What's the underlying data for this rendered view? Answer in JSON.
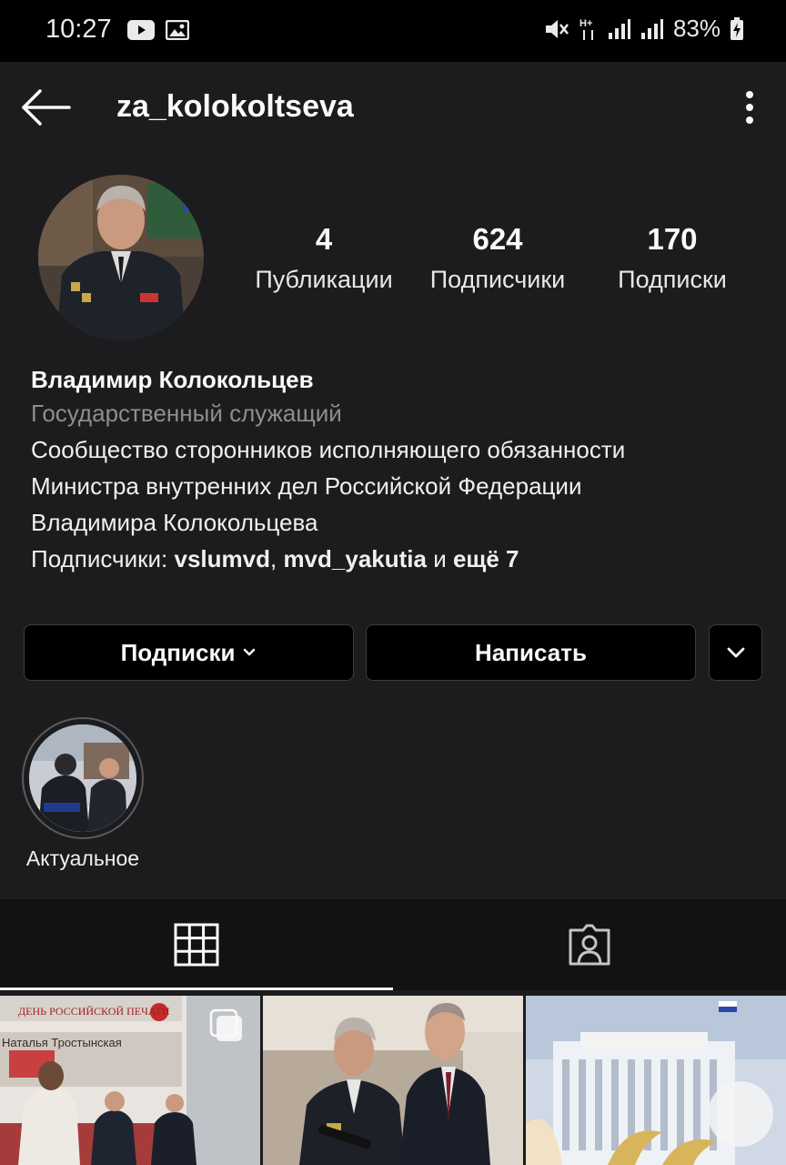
{
  "status_bar": {
    "time": "10:27",
    "battery": "83%",
    "icons": [
      "youtube-icon",
      "gallery-icon",
      "mute-icon",
      "network-h-plus-icon",
      "signal-icon",
      "signal-icon",
      "battery-charging-icon"
    ]
  },
  "header": {
    "username": "za_kolokoltseva",
    "back_icon": "arrow-left-icon",
    "more_icon": "more-vertical-icon"
  },
  "stats": [
    {
      "value": "4",
      "label": "Публикации"
    },
    {
      "value": "624",
      "label": "Подписчики"
    },
    {
      "value": "170",
      "label": "Подписки"
    }
  ],
  "bio": {
    "name": "Владимир Колокольцев",
    "category": "Государственный служащий",
    "lines": [
      "Сообщество сторонников исполняющего обязанности",
      "Министра внутренних дел Российской Федерации",
      "Владимира Колокольцева"
    ],
    "followed_by": {
      "prefix": "Подписчики: ",
      "user1": "vslumvd",
      "sep": ", ",
      "user2": "mvd_yakutia",
      "and": " и ",
      "more": "ещё 7"
    }
  },
  "actions": {
    "following_label": "Подписки",
    "message_label": "Написать"
  },
  "highlights": [
    {
      "label": "Актуальное"
    }
  ],
  "tabs": [
    {
      "name": "grid",
      "icon": "grid-icon",
      "active": true
    },
    {
      "name": "tagged",
      "icon": "tagged-person-icon",
      "active": false
    }
  ],
  "posts": [
    {
      "id": "post-1",
      "overlay_text_1": "ДЕНЬ РОССИЙСКОЙ ПЕЧАТИ",
      "overlay_text_2": "Наталья Тростынская",
      "multiple": true
    },
    {
      "id": "post-2"
    },
    {
      "id": "post-3"
    }
  ],
  "colors": {
    "background": "#1c1c1e",
    "status_bar": "#000000",
    "text_primary": "#fafafa",
    "text_secondary": "#8e8e8e",
    "button_border": "#3d3d40"
  }
}
